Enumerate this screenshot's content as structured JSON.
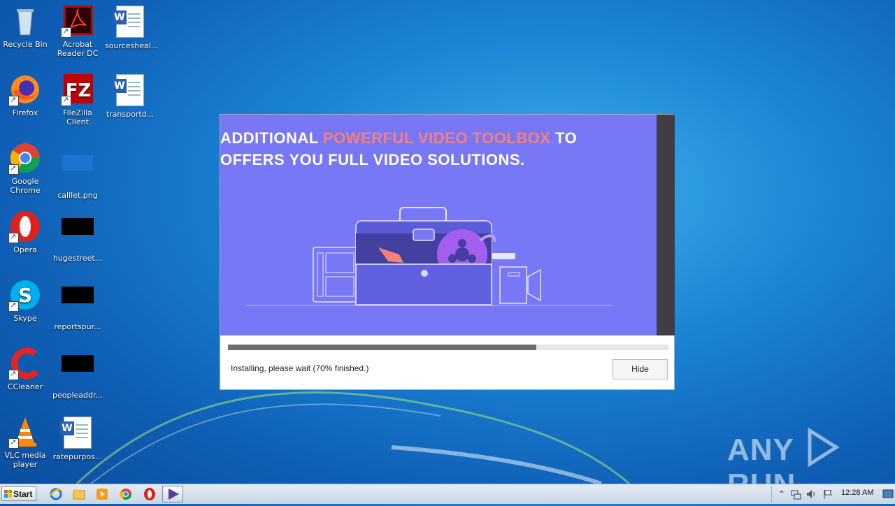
{
  "desktop_icons": [
    {
      "label": "Recycle Bin"
    },
    {
      "label": "Acrobat Reader DC"
    },
    {
      "label": "sourcesheal..."
    },
    {
      "label": "Firefox"
    },
    {
      "label": "FileZilla Client"
    },
    {
      "label": "transportd..."
    },
    {
      "label": "Google Chrome"
    },
    {
      "label": "calllet.png"
    },
    {
      "label": "Opera"
    },
    {
      "label": "hugestreet..."
    },
    {
      "label": "Skype"
    },
    {
      "label": "reportspur..."
    },
    {
      "label": "CCleaner"
    },
    {
      "label": "peopleaddr..."
    },
    {
      "label": "VLC media player"
    },
    {
      "label": "ratepurpos..."
    }
  ],
  "installer": {
    "headline_pre": "ADDITIONAL ",
    "headline_highlight": "POWERFUL VIDEO TOOLBOX",
    "headline_post": " TO",
    "headline_line2": "OFFERS YOU FULL VIDEO SOLUTIONS.",
    "progress_percent": 70,
    "status_text": "Installing, please wait (70% finished.)",
    "hide_label": "Hide",
    "colors": {
      "banner": "#7877f6",
      "highlight": "#f57f79",
      "progress": "#6e6e6e"
    }
  },
  "watermark": {
    "left": "ANY",
    "right": "RUN"
  },
  "taskbar": {
    "start_label": "Start",
    "quick_launch": [
      "ie-icon",
      "explorer-folder-icon",
      "media-player-icon",
      "chrome-icon",
      "opera-icon",
      "installer-app-icon"
    ],
    "tray_icons": [
      "show-hidden-icons",
      "network-icon",
      "volume-icon",
      "action-center-flag-icon"
    ],
    "clock": "12:28 AM"
  }
}
